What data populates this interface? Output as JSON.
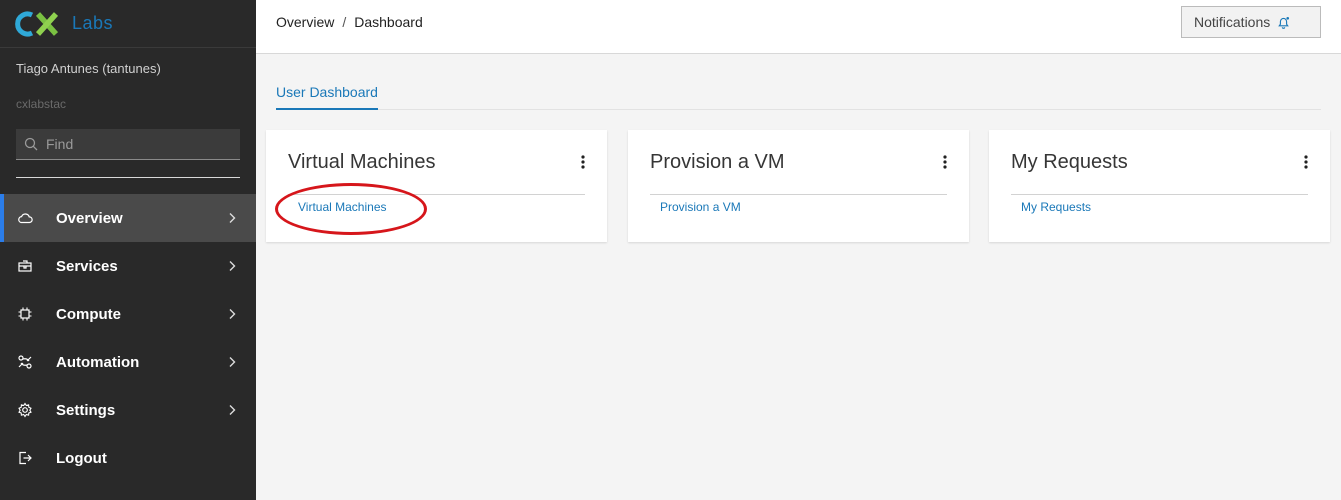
{
  "brand": {
    "logo_text": "CX",
    "labs": "Labs"
  },
  "user": {
    "name": "Tiago Antunes (tantunes)",
    "tenant": "cxlabstac"
  },
  "search": {
    "placeholder": "Find"
  },
  "nav": [
    {
      "label": "Overview",
      "icon": "cloud-icon",
      "active": true
    },
    {
      "label": "Services",
      "icon": "services-icon",
      "active": false
    },
    {
      "label": "Compute",
      "icon": "chip-icon",
      "active": false
    },
    {
      "label": "Automation",
      "icon": "automation-icon",
      "active": false
    },
    {
      "label": "Settings",
      "icon": "gear-icon",
      "active": false
    },
    {
      "label": "Logout",
      "icon": "logout-icon",
      "active": false
    }
  ],
  "breadcrumb": {
    "parent": "Overview",
    "separator": "/",
    "current": "Dashboard"
  },
  "notifications": {
    "label": "Notifications"
  },
  "tabs": [
    {
      "label": "User Dashboard"
    }
  ],
  "cards": [
    {
      "title": "Virtual Machines",
      "link": "Virtual Machines"
    },
    {
      "title": "Provision a VM",
      "link": "Provision a VM"
    },
    {
      "title": "My Requests",
      "link": "My Requests"
    }
  ],
  "colors": {
    "sidebar": "#292929",
    "accent": "#1a78b8",
    "active_border": "#2b7de9",
    "annotation": "#d6161b"
  }
}
